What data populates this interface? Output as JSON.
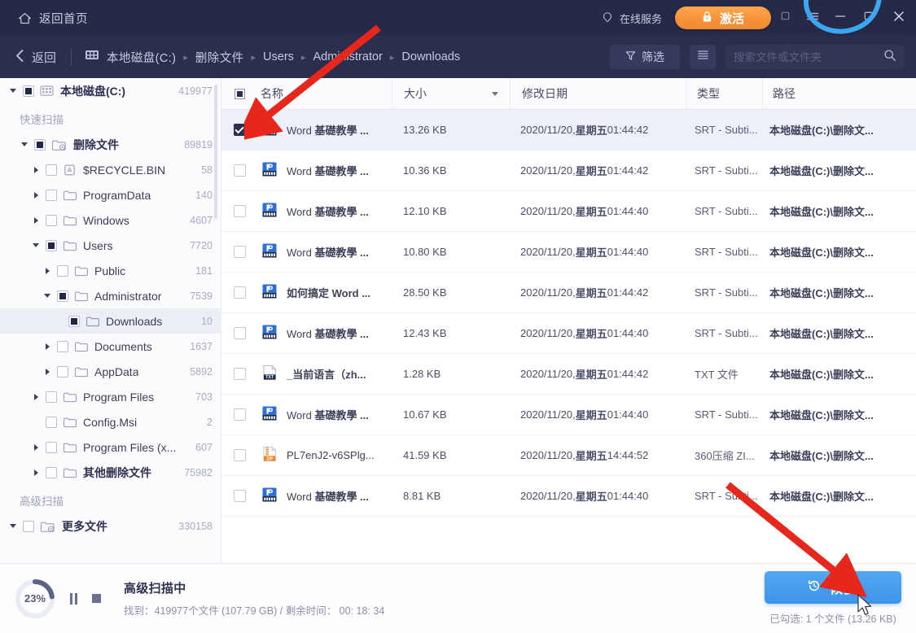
{
  "titlebar": {
    "home_label": "返回首页",
    "home_icon": "home-icon",
    "service_label": "在线服务",
    "service_icon": "headset-icon",
    "activate_label": "激活",
    "activate_icon": "lock-icon",
    "activate_color": "#f7923a",
    "win_restore_icon": "restore-icon",
    "win_menu_icon": "menu-icon",
    "win_minimize_icon": "minimize-icon",
    "win_maximize_icon": "maximize-icon",
    "win_close_icon": "close-icon",
    "bg_color": "#272a47"
  },
  "navbar": {
    "back_label": "返回",
    "back_icon": "chevron-left-icon",
    "disk_icon": "hard-disk-icon",
    "breadcrumbs": [
      "本地磁盘(C:)",
      "删除文件",
      "Users",
      "Administrator",
      "Downloads"
    ],
    "separator": "▸",
    "filter_label": "筛选",
    "filter_icon": "funnel-icon",
    "list_view_icon": "list-view-icon",
    "search_placeholder": "搜索文件或文件夹",
    "search_value": "",
    "search_icon": "search-icon",
    "bg_color": "#2b2e4d"
  },
  "sidebar": {
    "root": {
      "label": "本地磁盘(C:)",
      "count": "419977",
      "icon": "hard-disk-icon",
      "expanded": true,
      "checked": "partial"
    },
    "groups": [
      {
        "label": "快速扫描"
      },
      {
        "label": "高级扫描"
      }
    ],
    "items": [
      {
        "label": "删除文件",
        "count": "89819",
        "indent": 1,
        "icon": "deleted-folder-icon",
        "arrow": "down",
        "check": "partial",
        "zh": true
      },
      {
        "label": "$RECYCLE.BIN",
        "count": "58",
        "indent": 2,
        "icon": "recycle-bin-icon",
        "arrow": "right",
        "check": "empty",
        "zh": false
      },
      {
        "label": "ProgramData",
        "count": "140",
        "indent": 2,
        "icon": "folder-icon",
        "arrow": "right",
        "check": "empty",
        "zh": false
      },
      {
        "label": "Windows",
        "count": "4607",
        "indent": 2,
        "icon": "folder-icon",
        "arrow": "right",
        "check": "empty",
        "zh": false
      },
      {
        "label": "Users",
        "count": "7720",
        "indent": 2,
        "icon": "folder-icon",
        "arrow": "down",
        "check": "partial",
        "zh": false
      },
      {
        "label": "Public",
        "count": "181",
        "indent": 3,
        "icon": "folder-icon",
        "arrow": "right",
        "check": "empty",
        "zh": false
      },
      {
        "label": "Administrator",
        "count": "7539",
        "indent": 3,
        "icon": "folder-icon",
        "arrow": "down",
        "check": "partial",
        "zh": false
      },
      {
        "label": "Downloads",
        "count": "10",
        "indent": 4,
        "icon": "folder-icon",
        "arrow": "none",
        "check": "partial",
        "zh": false,
        "selected": true
      },
      {
        "label": "Documents",
        "count": "1637",
        "indent": 3,
        "icon": "folder-icon",
        "arrow": "right",
        "check": "empty",
        "zh": false
      },
      {
        "label": "AppData",
        "count": "5892",
        "indent": 3,
        "icon": "folder-icon",
        "arrow": "right",
        "check": "empty",
        "zh": false
      },
      {
        "label": "Program Files",
        "count": "703",
        "indent": 2,
        "icon": "folder-icon",
        "arrow": "right",
        "check": "empty",
        "zh": false
      },
      {
        "label": "Config.Msi",
        "count": "2",
        "indent": 2,
        "icon": "folder-icon",
        "arrow": "none",
        "check": "empty",
        "zh": false
      },
      {
        "label": "Program Files (x...",
        "count": "607",
        "indent": 2,
        "icon": "folder-icon",
        "arrow": "right",
        "check": "empty",
        "zh": false
      },
      {
        "label": "其他删除文件",
        "count": "75982",
        "indent": 2,
        "icon": "folder-icon",
        "arrow": "right",
        "check": "empty",
        "zh": true
      }
    ],
    "advanced_item": {
      "label": "更多文件",
      "count": "330158",
      "icon": "more-files-icon",
      "arrow": "down",
      "check": "empty"
    }
  },
  "table": {
    "headers": {
      "name": "名称",
      "size": "大小",
      "date": "修改日期",
      "type": "类型",
      "path": "路径"
    },
    "sort_column": "size",
    "rows": [
      {
        "checked": true,
        "icon": "srt-file-icon",
        "name_en": "Word ",
        "name_zh": "基礎教學 ...",
        "size": "13.26 KB",
        "date": "2020/11/20, 星期五 01:44:42",
        "type": "SRT - Subti...",
        "path": "本地磁盘(C:)\\删除文..."
      },
      {
        "checked": false,
        "icon": "srt-file-icon",
        "name_en": "Word ",
        "name_zh": "基礎教學 ...",
        "size": "10.36 KB",
        "date": "2020/11/20, 星期五 01:44:42",
        "type": "SRT - Subti...",
        "path": "本地磁盘(C:)\\删除文..."
      },
      {
        "checked": false,
        "icon": "srt-file-icon",
        "name_en": "Word ",
        "name_zh": "基礎教學 ...",
        "size": "12.10 KB",
        "date": "2020/11/20, 星期五 01:44:40",
        "type": "SRT - Subti...",
        "path": "本地磁盘(C:)\\删除文..."
      },
      {
        "checked": false,
        "icon": "srt-file-icon",
        "name_en": "Word ",
        "name_zh": "基礎教學 ...",
        "size": "10.80 KB",
        "date": "2020/11/20, 星期五 01:44:40",
        "type": "SRT - Subti...",
        "path": "本地磁盘(C:)\\删除文..."
      },
      {
        "checked": false,
        "icon": "srt-file-icon",
        "name_en": "",
        "name_zh": "如何搞定 Word ...",
        "size": "28.50 KB",
        "date": "2020/11/20, 星期五 01:44:42",
        "type": "SRT - Subti...",
        "path": "本地磁盘(C:)\\删除文..."
      },
      {
        "checked": false,
        "icon": "srt-file-icon",
        "name_en": "Word ",
        "name_zh": "基礎教學 ...",
        "size": "12.43 KB",
        "date": "2020/11/20, 星期五 01:44:40",
        "type": "SRT - Subti...",
        "path": "本地磁盘(C:)\\删除文..."
      },
      {
        "checked": false,
        "icon": "txt-file-icon",
        "name_en": "",
        "name_zh": "_当前语言（zh...",
        "size": "1.28 KB",
        "date": "2020/11/20, 星期五 01:44:42",
        "type": "TXT 文件",
        "path": "本地磁盘(C:)\\删除文..."
      },
      {
        "checked": false,
        "icon": "srt-file-icon",
        "name_en": "Word ",
        "name_zh": "基礎教學 ...",
        "size": "10.67 KB",
        "date": "2020/11/20, 星期五 01:44:40",
        "type": "SRT - Subti...",
        "path": "本地磁盘(C:)\\删除文..."
      },
      {
        "checked": false,
        "icon": "zip-file-icon",
        "name_en": "PL7enJ2-v6SPlg...",
        "name_zh": "",
        "size": "41.59 KB",
        "date": "2020/11/20, 星期五 14:44:52",
        "type": "360压缩 ZI...",
        "path": "本地磁盘(C:)\\删除文..."
      },
      {
        "checked": false,
        "icon": "srt-file-icon",
        "name_en": "Word ",
        "name_zh": "基礎教學 ...",
        "size": "8.81 KB",
        "date": "2020/11/20, 星期五 01:44:40",
        "type": "SRT - Subti...",
        "path": "本地磁盘(C:)\\删除文..."
      }
    ]
  },
  "footer": {
    "progress_percent": "23%",
    "progress_value": 23,
    "pause_icon": "pause-icon",
    "stop_icon": "stop-icon",
    "scan_title": "高级扫描中",
    "scan_detail": "找到：419977个文件 (107.79 GB) / 剩余时间： 00: 18: 34",
    "recover_label": "恢复",
    "recover_icon": "restore-clock-icon",
    "recover_color": "#3d94ea",
    "selection_info": "已勾选: 1 个文件 (13.26 KB)"
  },
  "annotations": {
    "arrow_color": "#e8271c",
    "circle_color": "#3ba7f0"
  }
}
